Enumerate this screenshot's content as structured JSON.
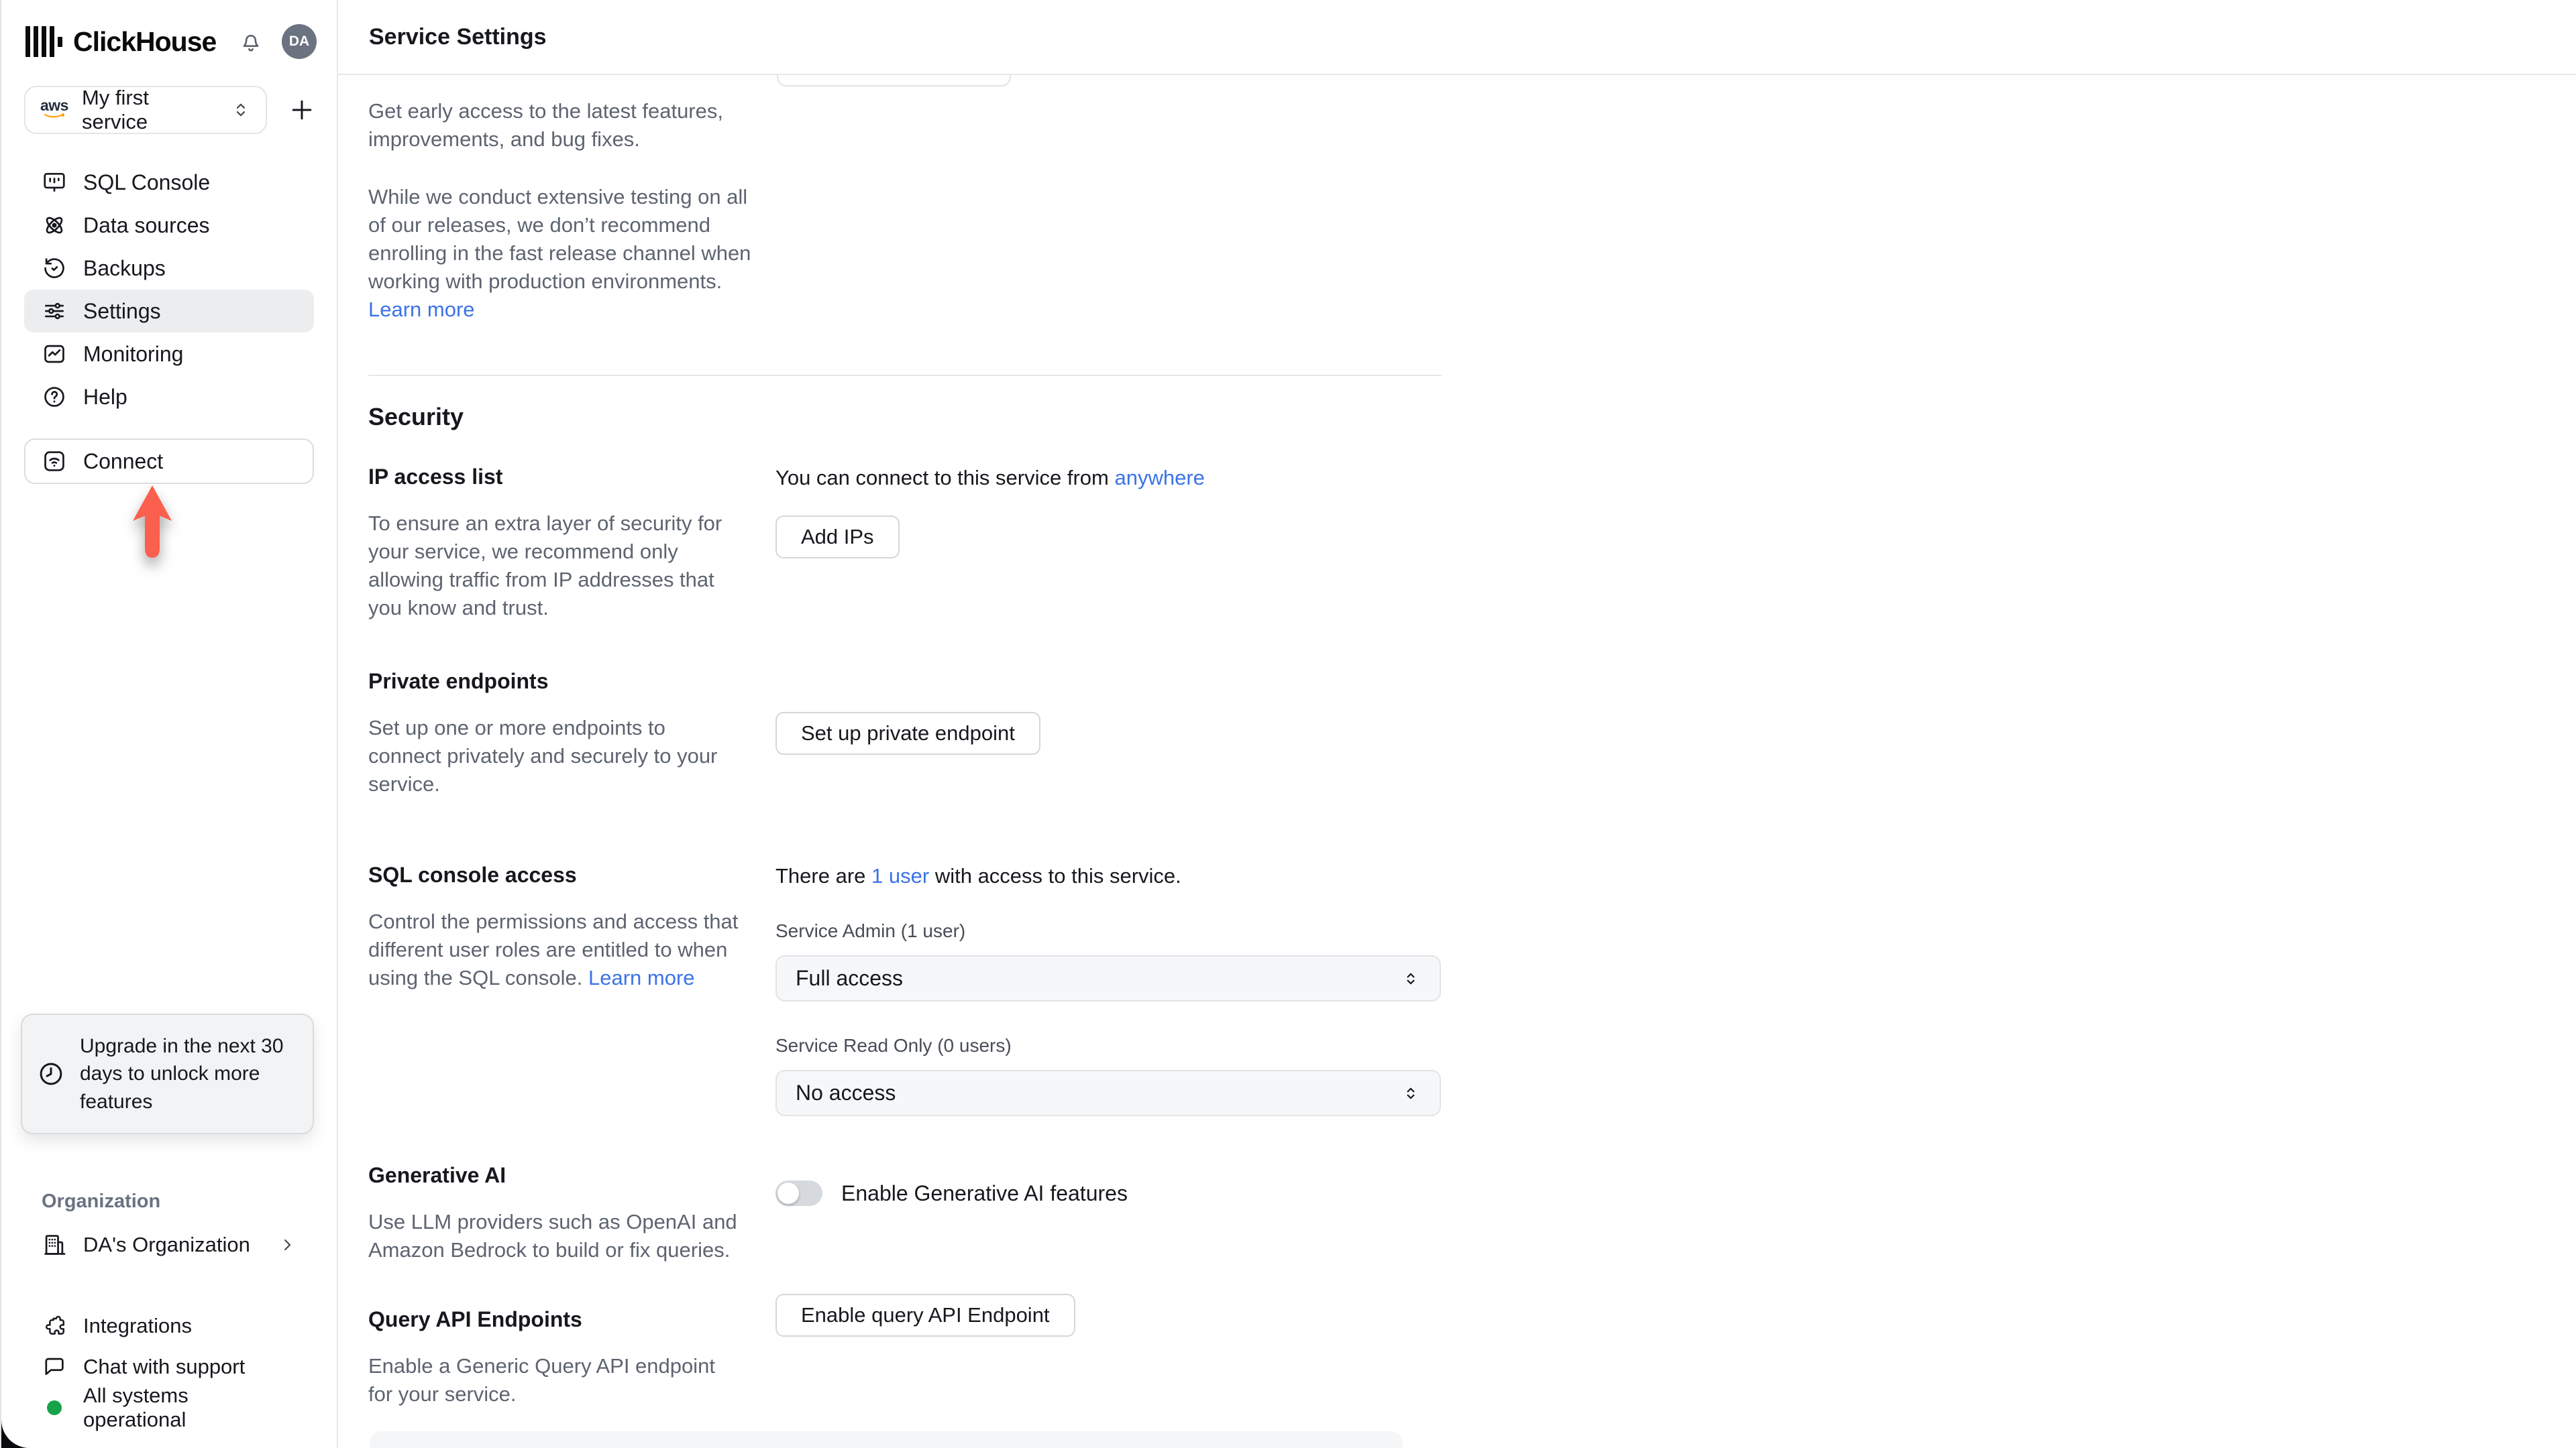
{
  "colors": {
    "link_blue": "#3B73E8",
    "arrow_coral": "#FB5F4E",
    "status_green": "#16A34A",
    "active_item_bg": "#ECEDEF",
    "avatar_bg": "#6B7280",
    "toggle_track": "#D6DADF"
  },
  "header": {
    "brand": "ClickHouse",
    "avatar_initials": "DA"
  },
  "sidebar": {
    "service": {
      "name": "My first service",
      "provider": "aws"
    },
    "nav": [
      {
        "id": "sql-console",
        "label": "SQL Console"
      },
      {
        "id": "data-sources",
        "label": "Data sources"
      },
      {
        "id": "backups",
        "label": "Backups"
      },
      {
        "id": "settings",
        "label": "Settings",
        "active": true
      },
      {
        "id": "monitoring",
        "label": "Monitoring"
      },
      {
        "id": "help",
        "label": "Help"
      }
    ],
    "connect_label": "Connect",
    "upgrade_notice": "Upgrade in the next 30 days to unlock more features",
    "organization": {
      "section_label": "Organization",
      "name": "DA's Organization"
    },
    "footer": [
      {
        "id": "integrations",
        "label": "Integrations"
      },
      {
        "id": "chat-with-support",
        "label": "Chat with support"
      },
      {
        "id": "system-status",
        "label": "All systems operational"
      }
    ]
  },
  "main": {
    "title": "Service Settings",
    "release": {
      "p1": "Get early access to the latest features, improvements, and bug fixes.",
      "p2": "While we conduct extensive testing on all of our releases, we don’t recommend enrolling in the fast release channel when working with production environments.",
      "learn_more": "Learn more"
    },
    "security": {
      "heading": "Security",
      "ip_access": {
        "title": "IP access list",
        "description": "To ensure an extra layer of security for your service, we recommend only allowing traffic from IP addresses that you know and trust.",
        "connect_prefix": "You can connect to this service from",
        "connect_link": "anywhere",
        "button": "Add IPs"
      },
      "private_endpoints": {
        "title": "Private endpoints",
        "description": "Set up one or more endpoints to connect privately and securely to your service.",
        "button": "Set up private endpoint"
      },
      "sql_access": {
        "title": "SQL console access",
        "description": "Control the permissions and access that different user roles are entitled to when using the SQL console.",
        "learn_more": "Learn more",
        "users_prefix": "There are",
        "users_link": "1 user",
        "users_suffix": "with access to this service.",
        "admin_label": "Service Admin (1 user)",
        "admin_value": "Full access",
        "readonly_label": "Service Read Only (0 users)",
        "readonly_value": "No access"
      },
      "generative_ai": {
        "title": "Generative AI",
        "description": "Use LLM providers such as OpenAI and Amazon Bedrock to build or fix queries.",
        "toggle_label": "Enable Generative AI features",
        "toggle_state": "off"
      },
      "query_api": {
        "title": "Query API Endpoints",
        "description": "Enable a Generic Query API endpoint for your service.",
        "button": "Enable query API Endpoint"
      }
    }
  }
}
